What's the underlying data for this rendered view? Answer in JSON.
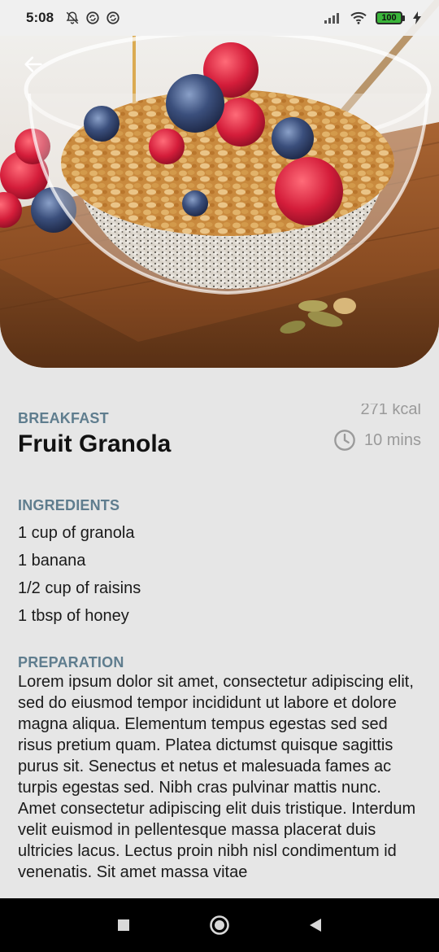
{
  "status_bar": {
    "time": "5:08",
    "battery": "100",
    "left_icons": [
      "bell-off-icon",
      "sync-icon",
      "sync-icon"
    ],
    "right_icons": [
      "signal-icon",
      "wifi-icon",
      "battery-icon",
      "charging-icon"
    ]
  },
  "header": {
    "back_icon": "arrow-left-icon",
    "image": "granola-bowl-photo"
  },
  "recipe": {
    "category": "BREAKFAST",
    "title": "Fruit Granola",
    "calories": "271 kcal",
    "time": "10 mins",
    "time_icon": "clock-icon"
  },
  "ingredients": {
    "title": "INGREDIENTS",
    "items": [
      "1 cup of granola",
      "1 banana",
      "1/2 cup of raisins",
      "1 tbsp of honey"
    ]
  },
  "preparation": {
    "title": "PREPARATION",
    "text": "Lorem ipsum dolor sit amet, consectetur adipiscing elit, sed do eiusmod tempor incididunt ut labore et dolore magna aliqua. Elementum tempus egestas sed sed risus pretium quam. Platea dictumst quisque sagittis purus sit. Senectus et netus et malesuada fames ac turpis egestas sed. Nibh cras pulvinar mattis nunc. Amet consectetur adipiscing elit duis tristique. Interdum velit euismod in pellentesque massa placerat duis ultricies lacus. Lectus proin nibh nisl condimentum id venenatis. Sit amet massa vitae"
  },
  "nav_bar": {
    "buttons": [
      "recents-square-icon",
      "home-circle-icon",
      "back-triangle-icon"
    ]
  },
  "colors": {
    "background": "#e6e6e6",
    "section_label": "#5f7d8e",
    "meta_text": "#9a9a9a",
    "battery": "#3ab53a"
  }
}
